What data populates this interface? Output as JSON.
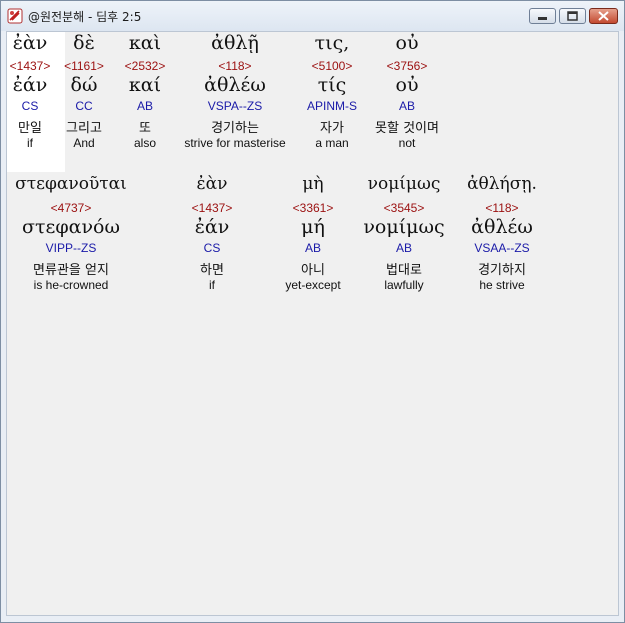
{
  "window": {
    "title": "@원전분해 - 딤후 2:5",
    "minimize_icon": "minimize-icon",
    "maximize_icon": "maximize-icon",
    "close_icon": "close-icon"
  },
  "rows": [
    {
      "words": [
        {
          "greek": "ἐὰν",
          "strong": "<1437>",
          "lemma": "ἐάν",
          "parse": "CS",
          "korean": "만일",
          "english": "if"
        },
        {
          "greek": "δὲ",
          "strong": "<1161>",
          "lemma": "δώ",
          "parse": "CC",
          "korean": "그리고",
          "english": "And"
        },
        {
          "greek": "καὶ",
          "strong": "<2532>",
          "lemma": "καί",
          "parse": "AB",
          "korean": "또",
          "english": "also"
        },
        {
          "greek": "ἀθλῇ",
          "strong": "<118>",
          "lemma": "ἀθλέω",
          "parse": "VSPA--ZS",
          "korean": "경기하는",
          "english": "strive for masterise"
        },
        {
          "greek": "τις,",
          "strong": "<5100>",
          "lemma": "τίς",
          "parse": "APINM-S",
          "korean": "자가",
          "english": "a man"
        },
        {
          "greek": "οὐ",
          "strong": "<3756>",
          "lemma": "οὐ",
          "parse": "AB",
          "korean": "못할 것이며",
          "english": "not"
        }
      ]
    },
    {
      "words": [
        {
          "greek": "στεφανοῦται",
          "strong": "<4737>",
          "lemma": "στεφανόω",
          "parse": "VIPP--ZS",
          "korean": "면류관을 얻지",
          "english": "is he-crowned"
        },
        {
          "greek": "ἐὰν",
          "strong": "<1437>",
          "lemma": "ἐάν",
          "parse": "CS",
          "korean": "하면",
          "english": "if"
        },
        {
          "greek": "μὴ",
          "strong": "<3361>",
          "lemma": "μή",
          "parse": "AB",
          "korean": "아니",
          "english": "yet-except"
        },
        {
          "greek": "νομίμως",
          "strong": "<3545>",
          "lemma": "νομίμως",
          "parse": "AB",
          "korean": "법대로",
          "english": "lawfully"
        },
        {
          "greek": "ἀθλήσῃ.",
          "strong": "<118>",
          "lemma": "ἀθλέω",
          "parse": "VSAA--ZS",
          "korean": "경기하지",
          "english": "he strive"
        }
      ]
    }
  ]
}
